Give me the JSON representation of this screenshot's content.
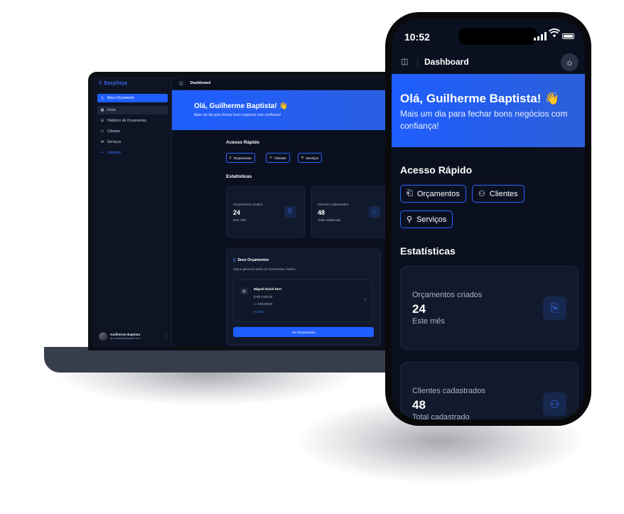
{
  "laptop": {
    "sidebar": {
      "brand": "EasyOrça",
      "items": [
        {
          "label": "Novo Orçamento",
          "icon": "file-plus-icon"
        },
        {
          "label": "Início",
          "icon": "grid-icon"
        },
        {
          "label": "Histórico de Orçamentos",
          "icon": "list-icon"
        },
        {
          "label": "Clientes",
          "icon": "users-icon"
        },
        {
          "label": "Serviços",
          "icon": "tools-icon"
        },
        {
          "label": "Upgrade",
          "icon": "sparkle-icon"
        }
      ],
      "user": {
        "name": "Guilherme Baptista",
        "email": "gui.baptista@gmail.com"
      }
    },
    "topbar": {
      "title": "Dashboard"
    },
    "hero": {
      "title": "Olá, Guilherme Baptista! 👋",
      "subtitle": "Mais um dia para fechar bons negócios com confiança!"
    },
    "quick_access": {
      "title": "Acesso Rápido",
      "buttons": [
        {
          "label": "Orçamentos",
          "icon": "file-icon"
        },
        {
          "label": "Clientes",
          "icon": "users-icon"
        },
        {
          "label": "Serviços",
          "icon": "wrench-icon"
        }
      ]
    },
    "stats": {
      "title": "Estatísticas",
      "cards": [
        {
          "label": "Orçamentos criados",
          "value": "24",
          "sub": "Este mês",
          "icon": "file-export-icon"
        },
        {
          "label": "Clientes cadastrados",
          "value": "48",
          "sub": "Total cadastrado",
          "icon": "users-icon"
        }
      ]
    },
    "budgets": {
      "title": "Seus Orçamentos",
      "subtitle": "Veja e gerencie todos os orçamentos criados.",
      "item": {
        "name": "Miguel David Hort",
        "value": "R$ 3.000,00",
        "date": "03/03/2025",
        "status": "enviado"
      },
      "button": "Ver Orçamentos"
    }
  },
  "phone": {
    "status_bar": {
      "time": "10:52"
    },
    "topbar": {
      "title": "Dashboard"
    },
    "hero": {
      "title": "Olá, Guilherme Baptista! 👋",
      "subtitle": "Mais um dia para fechar bons negócios com confiança!"
    },
    "quick_access": {
      "title": "Acesso Rápido",
      "buttons": [
        {
          "label": "Orçamentos",
          "icon": "file-icon"
        },
        {
          "label": "Clientes",
          "icon": "users-icon"
        },
        {
          "label": "Serviços",
          "icon": "wrench-icon"
        }
      ]
    },
    "stats": {
      "title": "Estatísticas",
      "cards": [
        {
          "label": "Orçamentos criados",
          "value": "24",
          "sub": "Este mês",
          "icon": "file-export-icon"
        },
        {
          "label": "Clientes cadastrados",
          "value": "48",
          "sub": "Total cadastrado",
          "icon": "users-icon"
        }
      ]
    }
  },
  "colors": {
    "accent": "#1f5eff",
    "background": "#0b1020",
    "card": "#111a2c"
  }
}
